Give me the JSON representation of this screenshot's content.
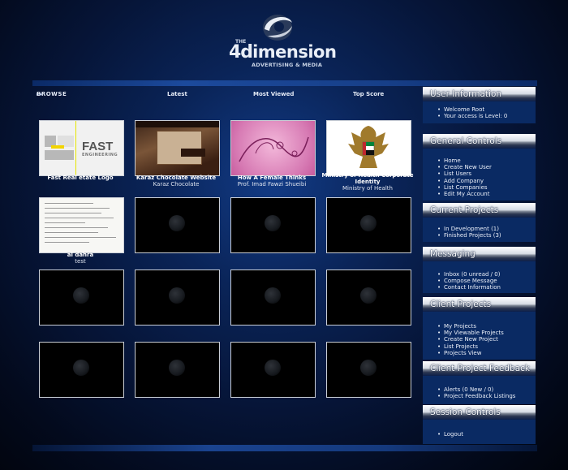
{
  "logo": {
    "the": "THE",
    "num": "4d",
    "word": "imension",
    "tagline": "ADVERTISING & MEDIA"
  },
  "tabs": {
    "browse": "BROWSE",
    "browse_arrows": "▸▸",
    "latest": "Latest",
    "most_viewed": "Most Viewed",
    "top_score": "Top Score"
  },
  "projects": [
    {
      "title": "Fast Real etate Logo",
      "subtitle": ""
    },
    {
      "title": "Karaz Chocolate Website",
      "subtitle": "Karaz Chocolate"
    },
    {
      "title": "How A Female Thinks",
      "subtitle": "Prof. Imad Fawzi Shueibi"
    },
    {
      "title": "Ministry of Health Corporate Identity",
      "subtitle": "Ministry of Health"
    },
    {
      "title": "al dahra",
      "subtitle": "test"
    }
  ],
  "thumb_text": {
    "fast": "FAST",
    "engineering": "ENGINEERING"
  },
  "sidebar": {
    "user_information": {
      "title": "User Information",
      "items": [
        "Welcome Root",
        "Your access is Level: 0"
      ]
    },
    "general_controls": {
      "title": "General Controls",
      "items": [
        "Home",
        "Create New User",
        "List Users",
        "Add Company",
        "List Companies",
        "Edit My Account"
      ]
    },
    "current_projects": {
      "title": "Current Projects",
      "items": [
        "In Development (1)",
        "Finished Projects (3)"
      ]
    },
    "messaging": {
      "title": "Messaging",
      "items": [
        "Inbox (0 unread / 0)",
        "Compose Message",
        "Contact Information"
      ]
    },
    "client_projects": {
      "title": "Client Projects",
      "items": [
        "My Projects",
        "My Viewable Projects",
        "Create New Project",
        "List Projects",
        "Projects View"
      ]
    },
    "client_project_feedback": {
      "title": "Client Project Feedback",
      "items": [
        "Alerts (0 New / 0)",
        "Project Feedback Listings"
      ]
    },
    "session_controls": {
      "title": "Session Controls",
      "items": [
        "Logout"
      ]
    }
  },
  "colors": {
    "background": "#061538",
    "panel_body": "#0a2a63",
    "accent_bar": "#1c4a9c"
  }
}
